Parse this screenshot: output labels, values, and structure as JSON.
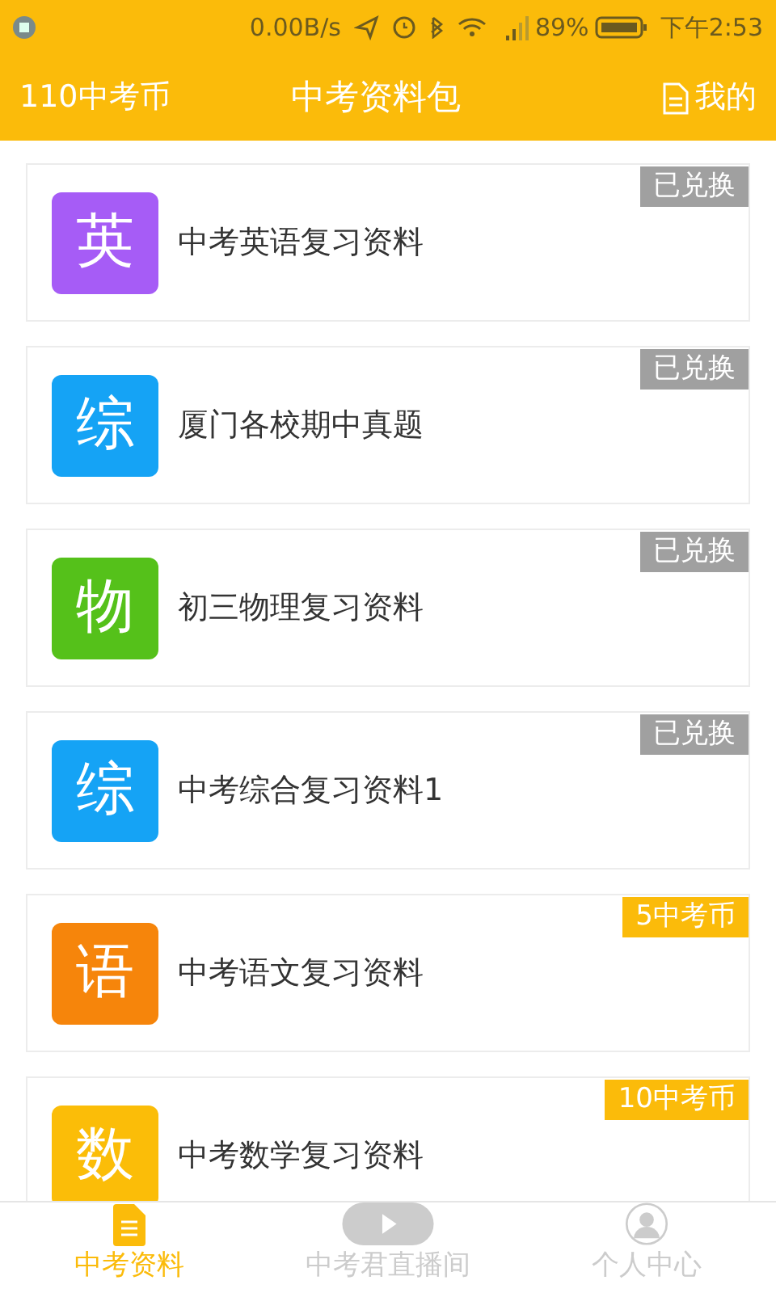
{
  "status_bar": {
    "speed": "0.00B/s",
    "battery": "89%",
    "time": "下午2:53"
  },
  "header": {
    "coins": "110中考币",
    "title": "中考资料包",
    "mine": "我的"
  },
  "items": [
    {
      "char": "英",
      "color": "#a65cf6",
      "title": "中考英语复习资料",
      "badge": {
        "kind": "redeemed",
        "text": "已兑换"
      }
    },
    {
      "char": "综",
      "color": "#15a3f5",
      "title": "厦门各校期中真题",
      "badge": {
        "kind": "redeemed",
        "text": "已兑换"
      }
    },
    {
      "char": "物",
      "color": "#55c11a",
      "title": "初三物理复习资料",
      "badge": {
        "kind": "redeemed",
        "text": "已兑换"
      }
    },
    {
      "char": "综",
      "color": "#15a3f5",
      "title": "中考综合复习资料1",
      "badge": {
        "kind": "redeemed",
        "text": "已兑换"
      }
    },
    {
      "char": "语",
      "color": "#f6850b",
      "title": "中考语文复习资料",
      "badge": {
        "kind": "price",
        "text": "5中考币"
      }
    },
    {
      "char": "数",
      "color": "#fbbd08",
      "title": "中考数学复习资料",
      "badge": {
        "kind": "price",
        "text": "10中考币"
      }
    }
  ],
  "tabs": [
    {
      "kind": "doc",
      "label": "中考资料",
      "selected": true
    },
    {
      "kind": "play",
      "label": "中考君直播间",
      "selected": false
    },
    {
      "kind": "person",
      "label": "个人中心",
      "selected": false
    }
  ]
}
